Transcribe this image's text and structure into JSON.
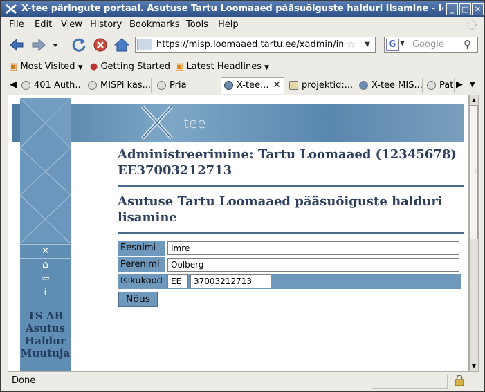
{
  "window": {
    "title": "X-tee päringute portaal. Asutuse Tartu Loomaaed pääsuõiguste halduri lisamine - Icewea"
  },
  "menu": [
    "File",
    "Edit",
    "View",
    "History",
    "Bookmarks",
    "Tools",
    "Help"
  ],
  "nav": {
    "url": "https://misp.loomaaed.tartu.ee/xadmin/inde",
    "search_placeholder": "Google"
  },
  "bookmarks": [
    "Most Visited",
    "Getting Started",
    "Latest Headlines"
  ],
  "tabs": [
    "401 Auth...",
    "MISPi kas...",
    "Pria",
    "X-tee...",
    "projektid:...",
    "X-tee MIS...",
    "Pat"
  ],
  "status": {
    "text": "Done"
  },
  "page": {
    "banner_text": "-tee",
    "heading1": "Administreerimine: Tartu Loomaaed (12345678) EE37003212713",
    "heading2": "Asutuse Tartu Loomaaed pääsuõiguste halduri lisamine",
    "sidebar_links": [
      "TS AB",
      "Asutus",
      "Haldur",
      "Muutuja"
    ],
    "form": {
      "firstname_label": "Eesnimi",
      "firstname_value": "Imre",
      "lastname_label": "Perenimi",
      "lastname_value": "Oolberg",
      "idcode_label": "Isikukood",
      "country_value": "EE",
      "idcode_value": "37003212713",
      "submit_label": "Nõus"
    }
  }
}
